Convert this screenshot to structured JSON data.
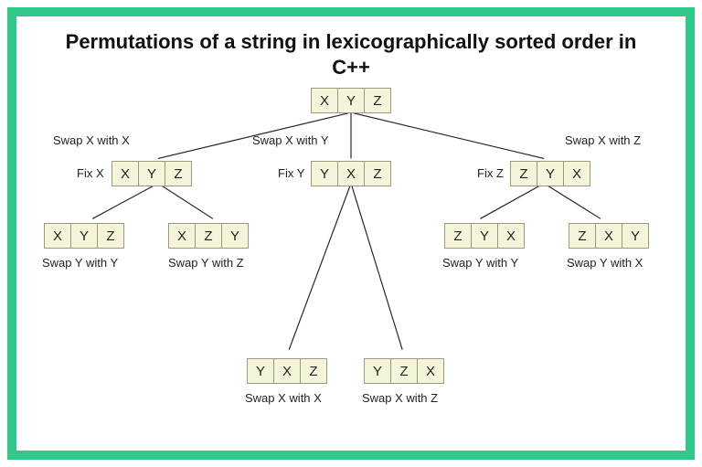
{
  "title": "Permutations of a string in lexicographically sorted order in C++",
  "root": {
    "chars": [
      "X",
      "Y",
      "Z"
    ]
  },
  "level1": {
    "left": {
      "swap": "Swap X with X",
      "fix": "Fix X",
      "chars": [
        "X",
        "Y",
        "Z"
      ]
    },
    "mid": {
      "swap": "Swap X with Y",
      "fix": "Fix Y",
      "chars": [
        "Y",
        "X",
        "Z"
      ]
    },
    "right": {
      "swap": "Swap X with Z",
      "fix": "Fix Z",
      "chars": [
        "Z",
        "Y",
        "X"
      ]
    }
  },
  "level2": {
    "ll": {
      "chars": [
        "X",
        "Y",
        "Z"
      ],
      "swap": "Swap Y with Y"
    },
    "lr": {
      "chars": [
        "X",
        "Z",
        "Y"
      ],
      "swap": "Swap Y with Z"
    },
    "rl": {
      "chars": [
        "Z",
        "Y",
        "X"
      ],
      "swap": "Swap Y with Y"
    },
    "rr": {
      "chars": [
        "Z",
        "X",
        "Y"
      ],
      "swap": "Swap Y with X"
    },
    "ml": {
      "chars": [
        "Y",
        "X",
        "Z"
      ],
      "swap": "Swap X with X"
    },
    "mr": {
      "chars": [
        "Y",
        "Z",
        "X"
      ],
      "swap": "Swap X with Z"
    }
  }
}
